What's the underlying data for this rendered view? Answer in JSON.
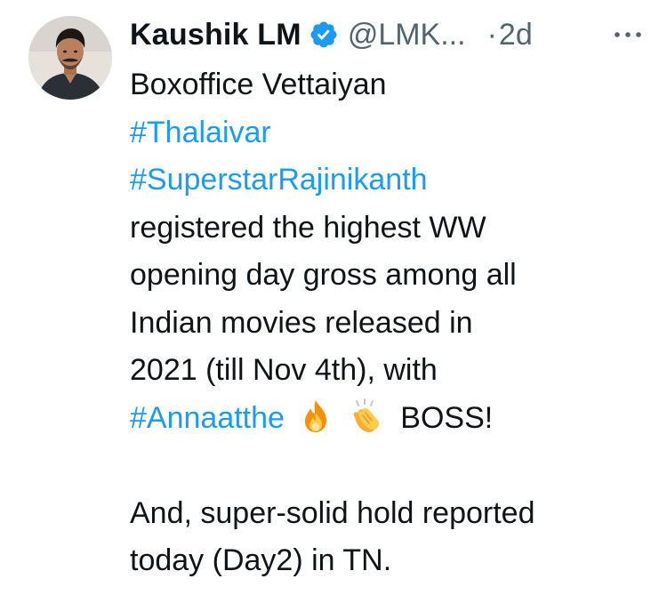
{
  "author": {
    "name": "Kaushik LM",
    "handle": "@LMK...",
    "separator": "·",
    "time": "2d",
    "avatar_icon": "avatar-photo",
    "verified_icon": "verified-badge-icon"
  },
  "menu": {
    "icon": "more-options-icon"
  },
  "tweet": {
    "line1": "Boxoffice Vettaiyan",
    "hashtag1": "#Thalaivar",
    "hashtag2": "#SuperstarRajinikanth",
    "line4": "registered the highest WW",
    "line5": "opening day gross among all",
    "line6": "Indian movies released in",
    "line7": "2021 (till Nov 4th), with",
    "hashtag3": "#Annaatthe",
    "emoji1": "fire-emoji",
    "emoji2": "clapping-hands-emoji",
    "line8_tail": "BOSS!",
    "line10": "And, super-solid hold reported",
    "line11": "today (Day2) in TN."
  },
  "colors": {
    "text": "#0f1419",
    "secondary": "#536471",
    "link": "#1d9bf0",
    "background": "#ffffff"
  }
}
